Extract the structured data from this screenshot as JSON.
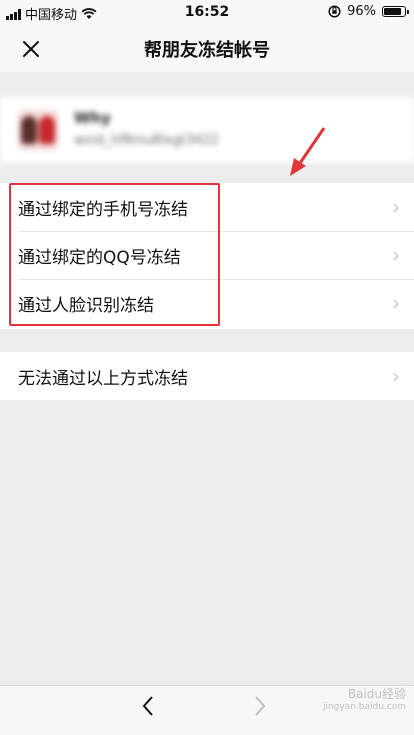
{
  "status": {
    "carrier": "中国移动",
    "time": "16:52",
    "battery_text": "96%",
    "battery_level": 0.96,
    "icons": [
      "signal-icon",
      "wifi-icon",
      "orientation-lock-icon",
      "battery-icon"
    ]
  },
  "nav": {
    "close_icon": "close-icon",
    "title": "帮朋友冻结帐号"
  },
  "user": {
    "name": "Why",
    "wxid": "wxid_hf8mu8lxgt3422"
  },
  "options": [
    {
      "label": "通过绑定的手机号冻结"
    },
    {
      "label": "通过绑定的QQ号冻结"
    },
    {
      "label": "通过人脸识别冻结"
    }
  ],
  "other_option": {
    "label": "无法通过以上方式冻结"
  },
  "annotation": {
    "box_color": "#e2353b",
    "arrow_color": "#e2353b"
  },
  "bottom": {
    "back_icon": "back-chevron-icon",
    "forward_icon": "forward-chevron-icon"
  },
  "watermark": {
    "text": "Baidu经验",
    "sub": "jingyan.baidu.com"
  }
}
